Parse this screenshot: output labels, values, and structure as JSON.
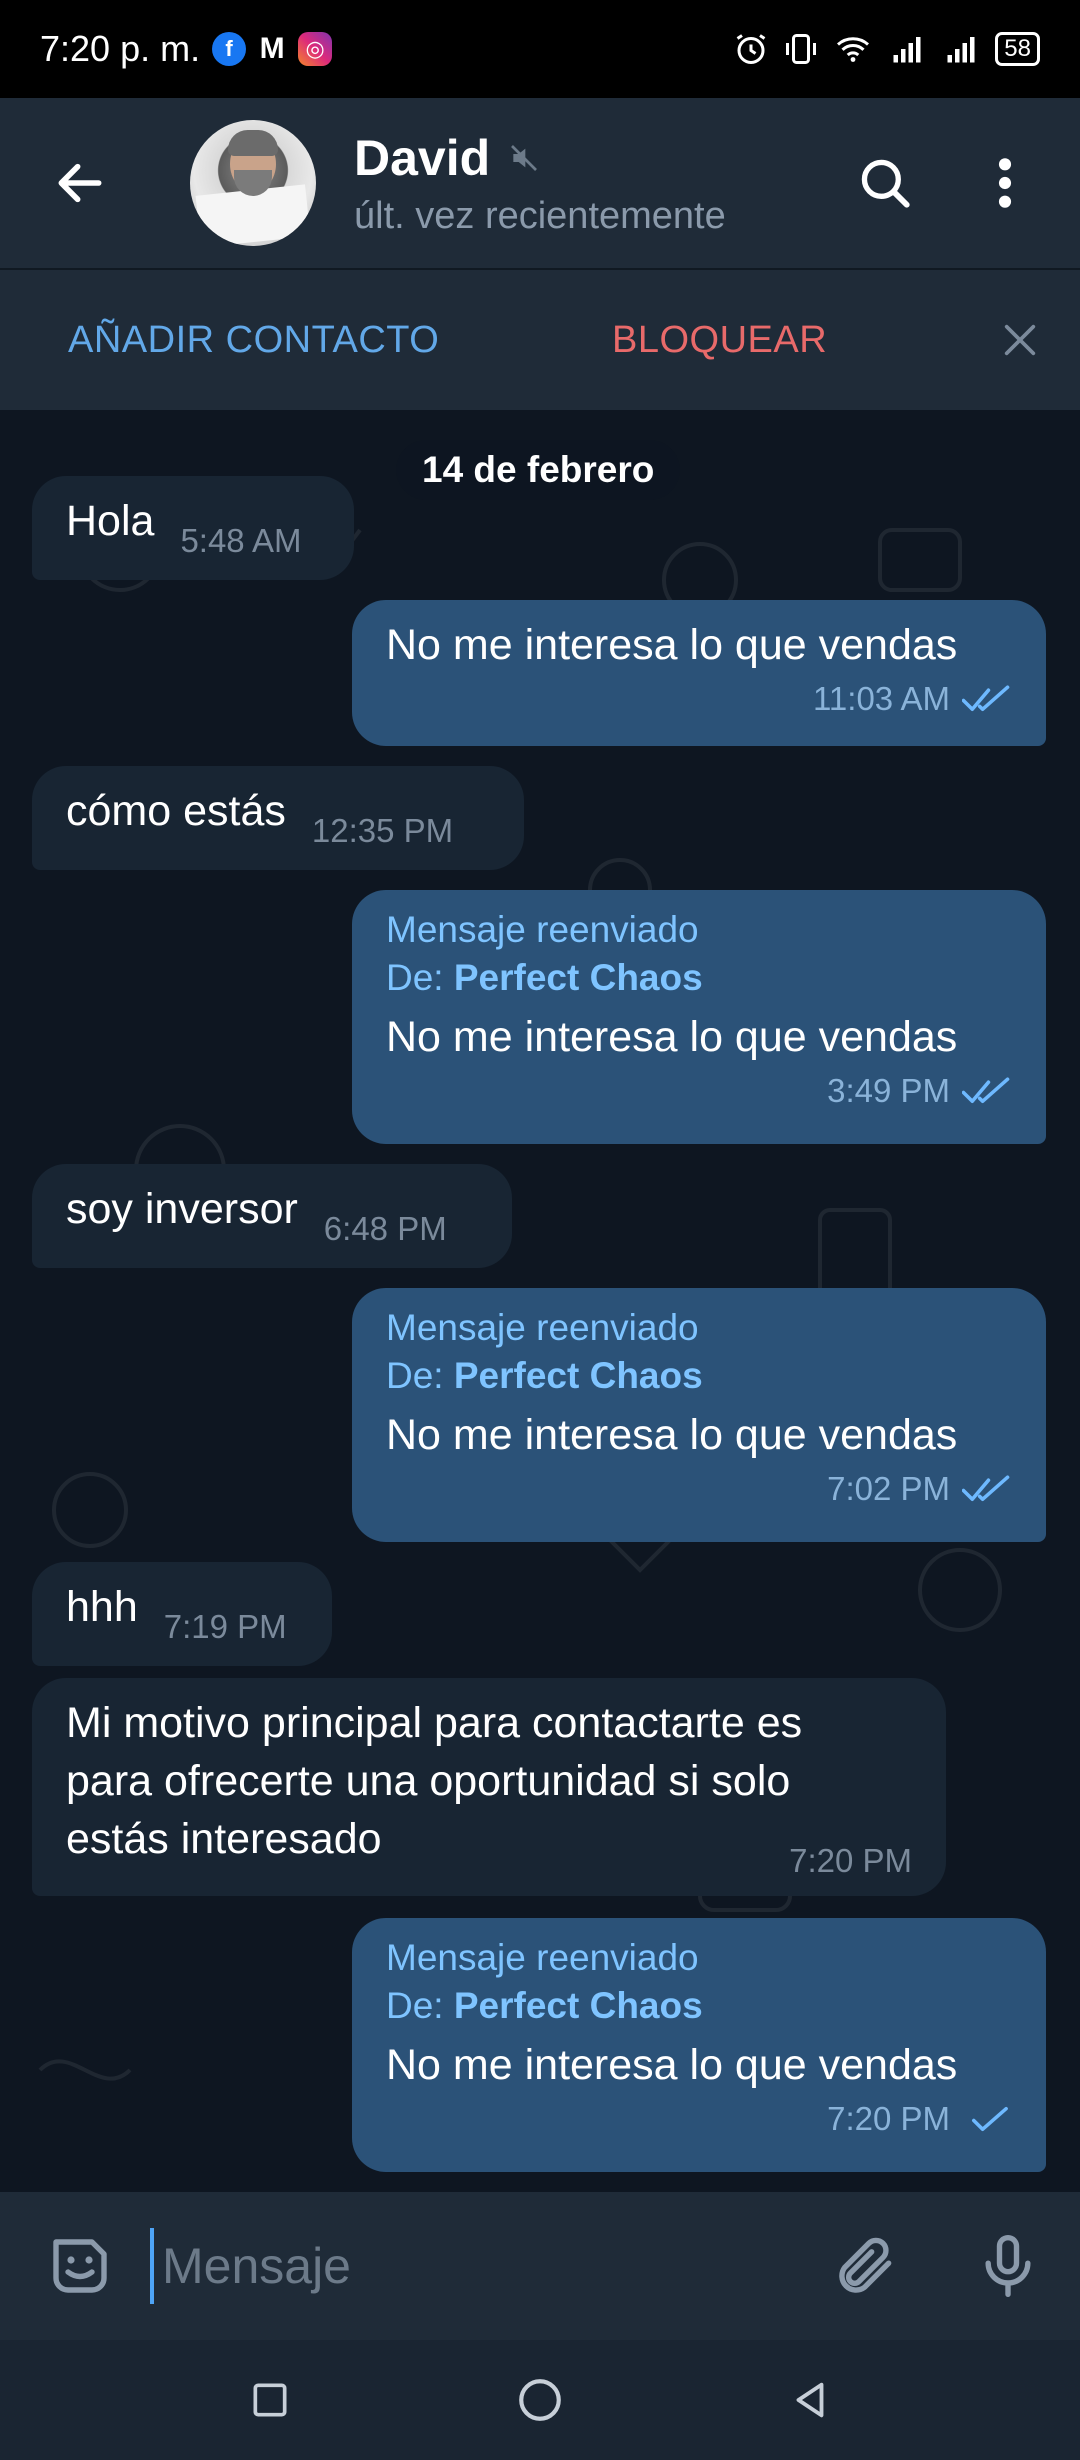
{
  "status_bar": {
    "time": "7:20 p. m.",
    "apps": [
      "facebook-icon",
      "gmail-icon",
      "instagram-icon"
    ],
    "battery": "58"
  },
  "header": {
    "contact_name": "David",
    "contact_status": "últ. vez recientemente"
  },
  "action_bar": {
    "add_contact": "AÑADIR CONTACTO",
    "block": "BLOQUEAR"
  },
  "chat": {
    "date": "14 de febrero",
    "messages": [
      {
        "dir": "in",
        "text": "Hola",
        "time": "5:48 AM"
      },
      {
        "dir": "out",
        "text": "No me interesa lo que vendas",
        "time": "11:03 AM",
        "read": true
      },
      {
        "dir": "in",
        "text": "cómo estás",
        "time": "12:35 PM"
      },
      {
        "dir": "out",
        "forwarded": true,
        "fwd_label": "Mensaje reenviado",
        "fwd_prefix": "De: ",
        "fwd_from": "Perfect Chaos",
        "text": "No me interesa lo que vendas",
        "time": "3:49 PM",
        "read": true
      },
      {
        "dir": "in",
        "text": "soy inversor",
        "time": "6:48 PM"
      },
      {
        "dir": "out",
        "forwarded": true,
        "fwd_label": "Mensaje reenviado",
        "fwd_prefix": "De: ",
        "fwd_from": "Perfect Chaos",
        "text": "No me interesa lo que vendas",
        "time": "7:02 PM",
        "read": true
      },
      {
        "dir": "in",
        "text": "hhh",
        "time": "7:19 PM"
      },
      {
        "dir": "in",
        "text_lines": [
          "Mi motivo principal para contactarte es",
          "para ofrecerte una oportunidad si solo",
          "estás interesado"
        ],
        "time": "7:20 PM"
      },
      {
        "dir": "out",
        "forwarded": true,
        "fwd_label": "Mensaje reenviado",
        "fwd_prefix": "De: ",
        "fwd_from": "Perfect Chaos",
        "text": "No me interesa lo que vendas",
        "time": "7:20 PM",
        "read": false
      }
    ]
  },
  "composer": {
    "placeholder": "Mensaje"
  },
  "colors": {
    "background": "#0e1621",
    "header": "#1f2b38",
    "bubble_in": "#182533",
    "bubble_out": "#2b5278",
    "accent": "#62a8e8",
    "danger": "#e86a6a"
  }
}
